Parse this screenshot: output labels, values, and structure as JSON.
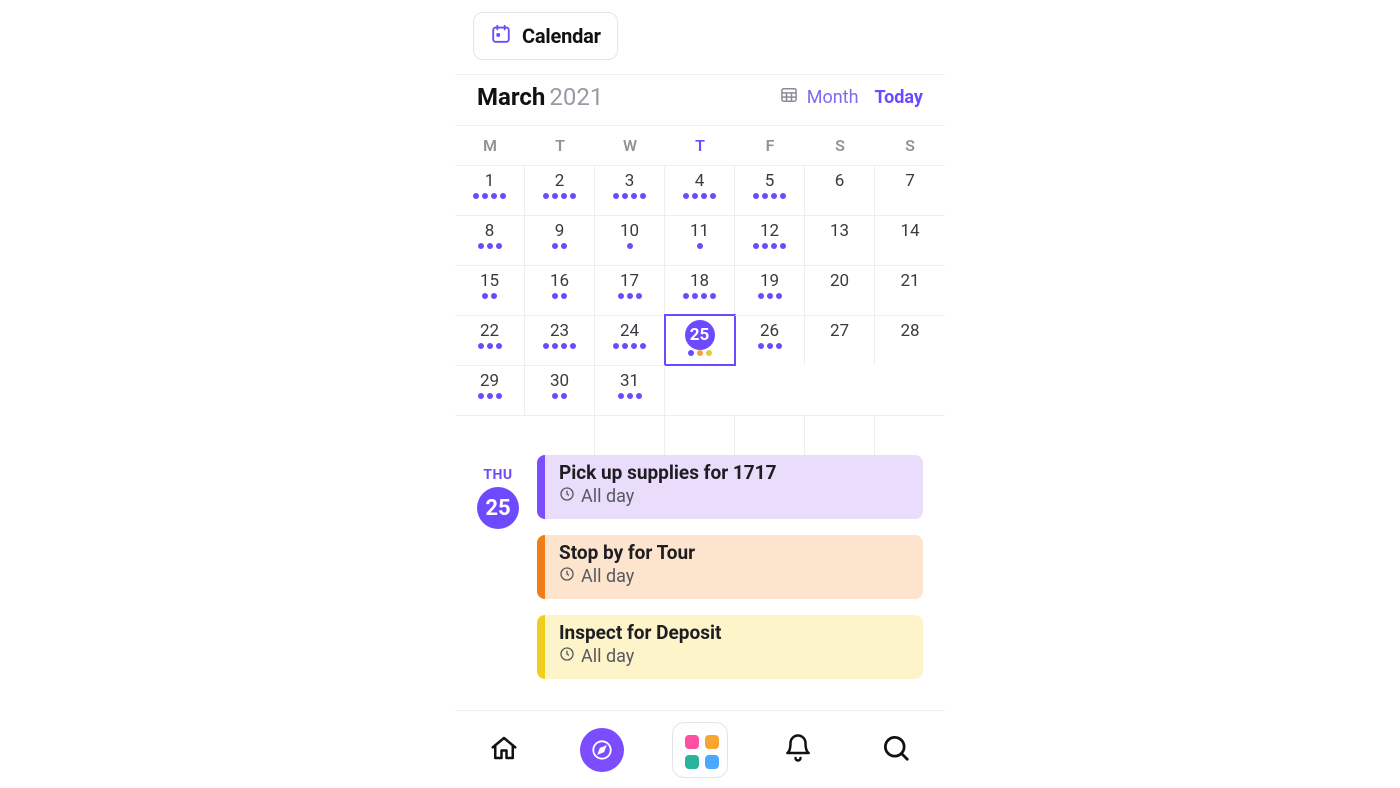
{
  "header": {
    "button_label": "Calendar"
  },
  "month_bar": {
    "month": "March",
    "year": "2021",
    "view_label": "Month",
    "today_label": "Today"
  },
  "weekdays": [
    "M",
    "T",
    "W",
    "T",
    "F",
    "S",
    "S"
  ],
  "today_weekday_index": 3,
  "days": [
    {
      "n": 1,
      "dots": [
        "p",
        "p",
        "p",
        "p"
      ]
    },
    {
      "n": 2,
      "dots": [
        "p",
        "p",
        "p",
        "p"
      ]
    },
    {
      "n": 3,
      "dots": [
        "p",
        "p",
        "p",
        "p"
      ]
    },
    {
      "n": 4,
      "dots": [
        "p",
        "p",
        "p",
        "p"
      ]
    },
    {
      "n": 5,
      "dots": [
        "p",
        "p",
        "p",
        "p"
      ]
    },
    {
      "n": 6,
      "dots": []
    },
    {
      "n": 7,
      "dots": []
    },
    {
      "n": 8,
      "dots": [
        "p",
        "p",
        "p"
      ]
    },
    {
      "n": 9,
      "dots": [
        "p",
        "p"
      ]
    },
    {
      "n": 10,
      "dots": [
        "p"
      ]
    },
    {
      "n": 11,
      "dots": [
        "p"
      ]
    },
    {
      "n": 12,
      "dots": [
        "p",
        "p",
        "p",
        "p"
      ]
    },
    {
      "n": 13,
      "dots": []
    },
    {
      "n": 14,
      "dots": []
    },
    {
      "n": 15,
      "dots": [
        "p",
        "p"
      ]
    },
    {
      "n": 16,
      "dots": [
        "p",
        "p"
      ]
    },
    {
      "n": 17,
      "dots": [
        "p",
        "p",
        "p"
      ]
    },
    {
      "n": 18,
      "dots": [
        "p",
        "p",
        "p",
        "p"
      ]
    },
    {
      "n": 19,
      "dots": [
        "p",
        "p",
        "p"
      ]
    },
    {
      "n": 20,
      "dots": []
    },
    {
      "n": 21,
      "dots": []
    },
    {
      "n": 22,
      "dots": [
        "p",
        "p",
        "p"
      ]
    },
    {
      "n": 23,
      "dots": [
        "p",
        "p",
        "p",
        "p"
      ]
    },
    {
      "n": 24,
      "dots": [
        "p",
        "p",
        "p",
        "p"
      ]
    },
    {
      "n": 25,
      "dots": [
        "p",
        "o",
        "y"
      ],
      "selected": true
    },
    {
      "n": 26,
      "dots": [
        "p",
        "p",
        "p"
      ]
    },
    {
      "n": 27,
      "dots": []
    },
    {
      "n": 28,
      "dots": []
    },
    {
      "n": 29,
      "dots": [
        "p",
        "p",
        "p"
      ]
    },
    {
      "n": 30,
      "dots": [
        "p",
        "p"
      ]
    },
    {
      "n": 31,
      "dots": [
        "p",
        "p",
        "p"
      ]
    }
  ],
  "selected_day": {
    "dow": "THU",
    "num": "25"
  },
  "events": [
    {
      "title": "Pick up supplies for 1717",
      "time": "All day",
      "color": "purple"
    },
    {
      "title": "Stop by for Tour",
      "time": "All day",
      "color": "orange"
    },
    {
      "title": "Inspect for Deposit",
      "time": "All day",
      "color": "yellow"
    }
  ],
  "nav_apps_colors": [
    "#ff4fa3",
    "#f6a531",
    "#2ab39b",
    "#4aa8ff"
  ]
}
